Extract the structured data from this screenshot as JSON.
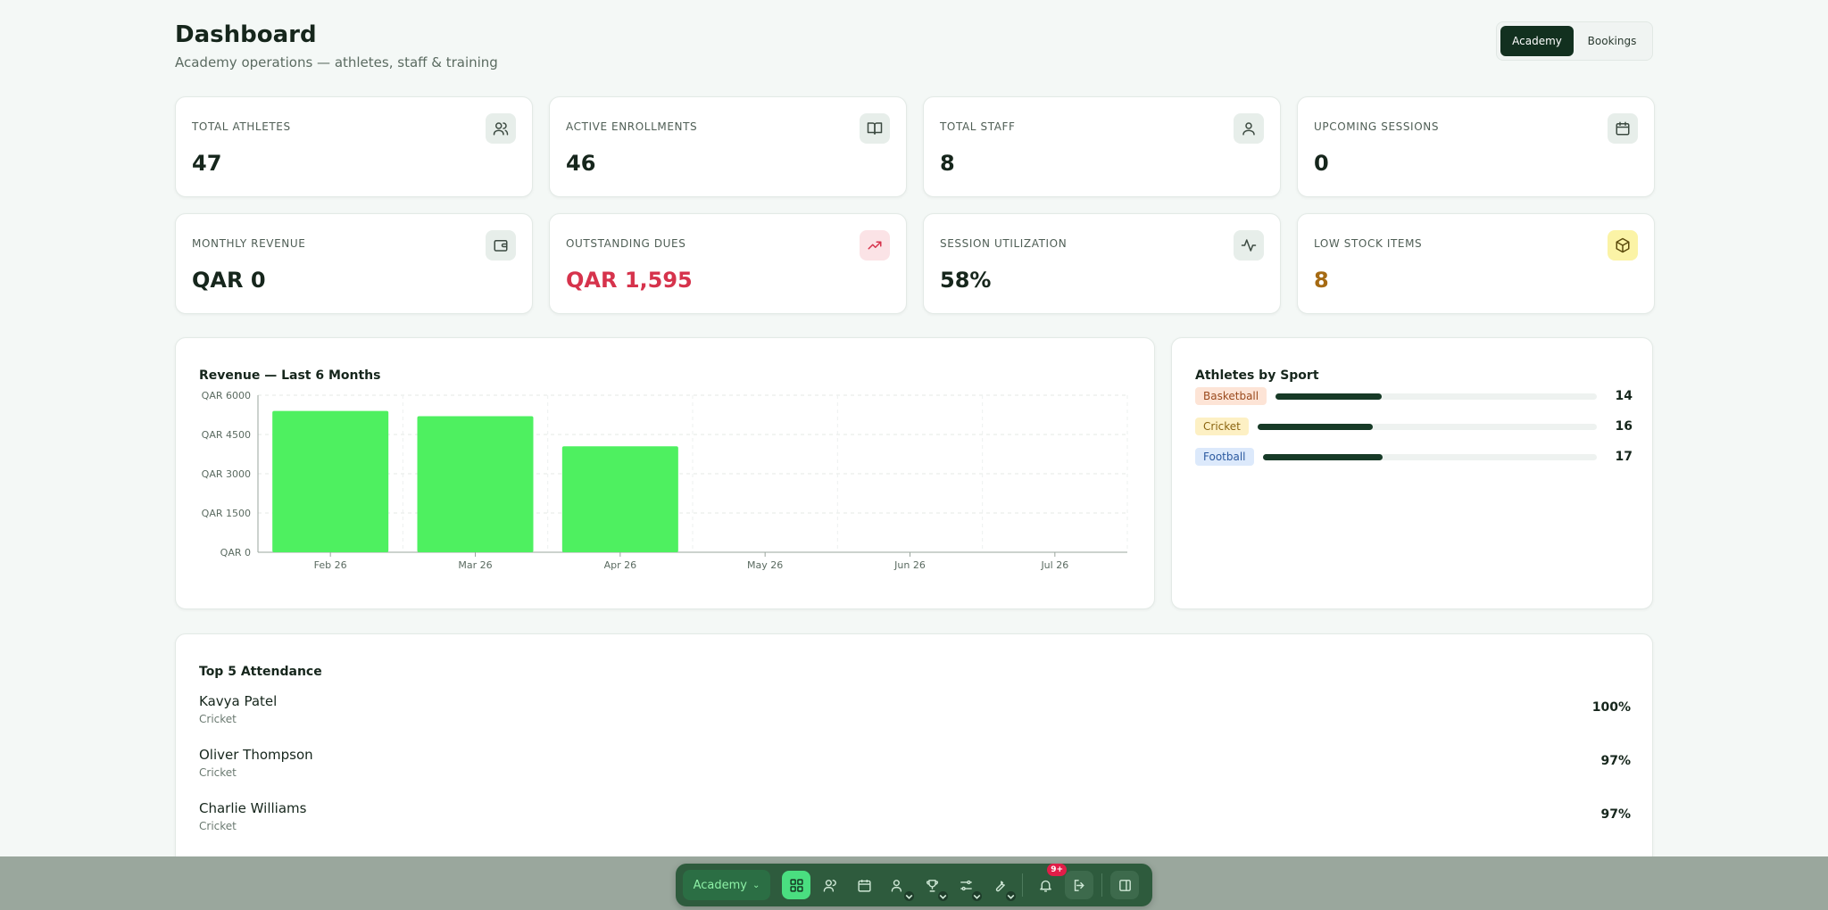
{
  "header": {
    "title": "Dashboard",
    "subtitle": "Academy operations — athletes, staff & training",
    "modes": [
      "Academy",
      "Bookings"
    ]
  },
  "stats": [
    {
      "label": "TOTAL ATHLETES",
      "value": "47",
      "icon": "users-icon"
    },
    {
      "label": "ACTIVE ENROLLMENTS",
      "value": "46",
      "icon": "book-icon"
    },
    {
      "label": "TOTAL STAFF",
      "value": "8",
      "icon": "user-icon"
    },
    {
      "label": "UPCOMING SESSIONS",
      "value": "0",
      "icon": "calendar-icon"
    },
    {
      "label": "MONTHLY REVENUE",
      "value": "QAR 0",
      "icon": "wallet-icon"
    },
    {
      "label": "OUTSTANDING DUES",
      "value": "QAR 1,595",
      "icon": "trending-up-icon",
      "color": "#d6334c"
    },
    {
      "label": "SESSION UTILIZATION",
      "value": "58%",
      "icon": "activity-icon"
    },
    {
      "label": "LOW STOCK ITEMS",
      "value": "8",
      "icon": "package-icon",
      "color": "#a56a13"
    }
  ],
  "revenue": {
    "title": "Revenue — Last 6 Months"
  },
  "chart_data": {
    "type": "bar",
    "title": "Revenue — Last 6 Months",
    "categories": [
      "Feb 26",
      "Mar 26",
      "Apr 26",
      "May 26",
      "Jun 26",
      "Jul 26"
    ],
    "values": [
      5400,
      5200,
      4050,
      0,
      0,
      0
    ],
    "yticks": [
      "QAR 0",
      "QAR 1500",
      "QAR 3000",
      "QAR 4500",
      "QAR 6000"
    ],
    "ylim": [
      0,
      6000
    ],
    "grid": true,
    "bar_color": "#4ef060"
  },
  "sports": {
    "title": "Athletes by Sport",
    "items": [
      {
        "name": "Basketball",
        "count": "14",
        "value": 14,
        "bg": "#fde4d6",
        "fg": "#9a4a1d"
      },
      {
        "name": "Cricket",
        "count": "16",
        "value": 16,
        "bg": "#fdf0c4",
        "fg": "#8a6410"
      },
      {
        "name": "Football",
        "count": "17",
        "value": 17,
        "bg": "#dce9fb",
        "fg": "#2c5aa0"
      }
    ]
  },
  "attendance": {
    "title": "Top 5 Attendance",
    "rows": [
      {
        "name": "Kavya Patel",
        "sport": "Cricket",
        "pct": "100%"
      },
      {
        "name": "Oliver Thompson",
        "sport": "Cricket",
        "pct": "97%"
      },
      {
        "name": "Charlie Williams",
        "sport": "Cricket",
        "pct": "97%"
      }
    ]
  },
  "dock": {
    "select_label": "Academy",
    "notif_badge": "9+"
  }
}
